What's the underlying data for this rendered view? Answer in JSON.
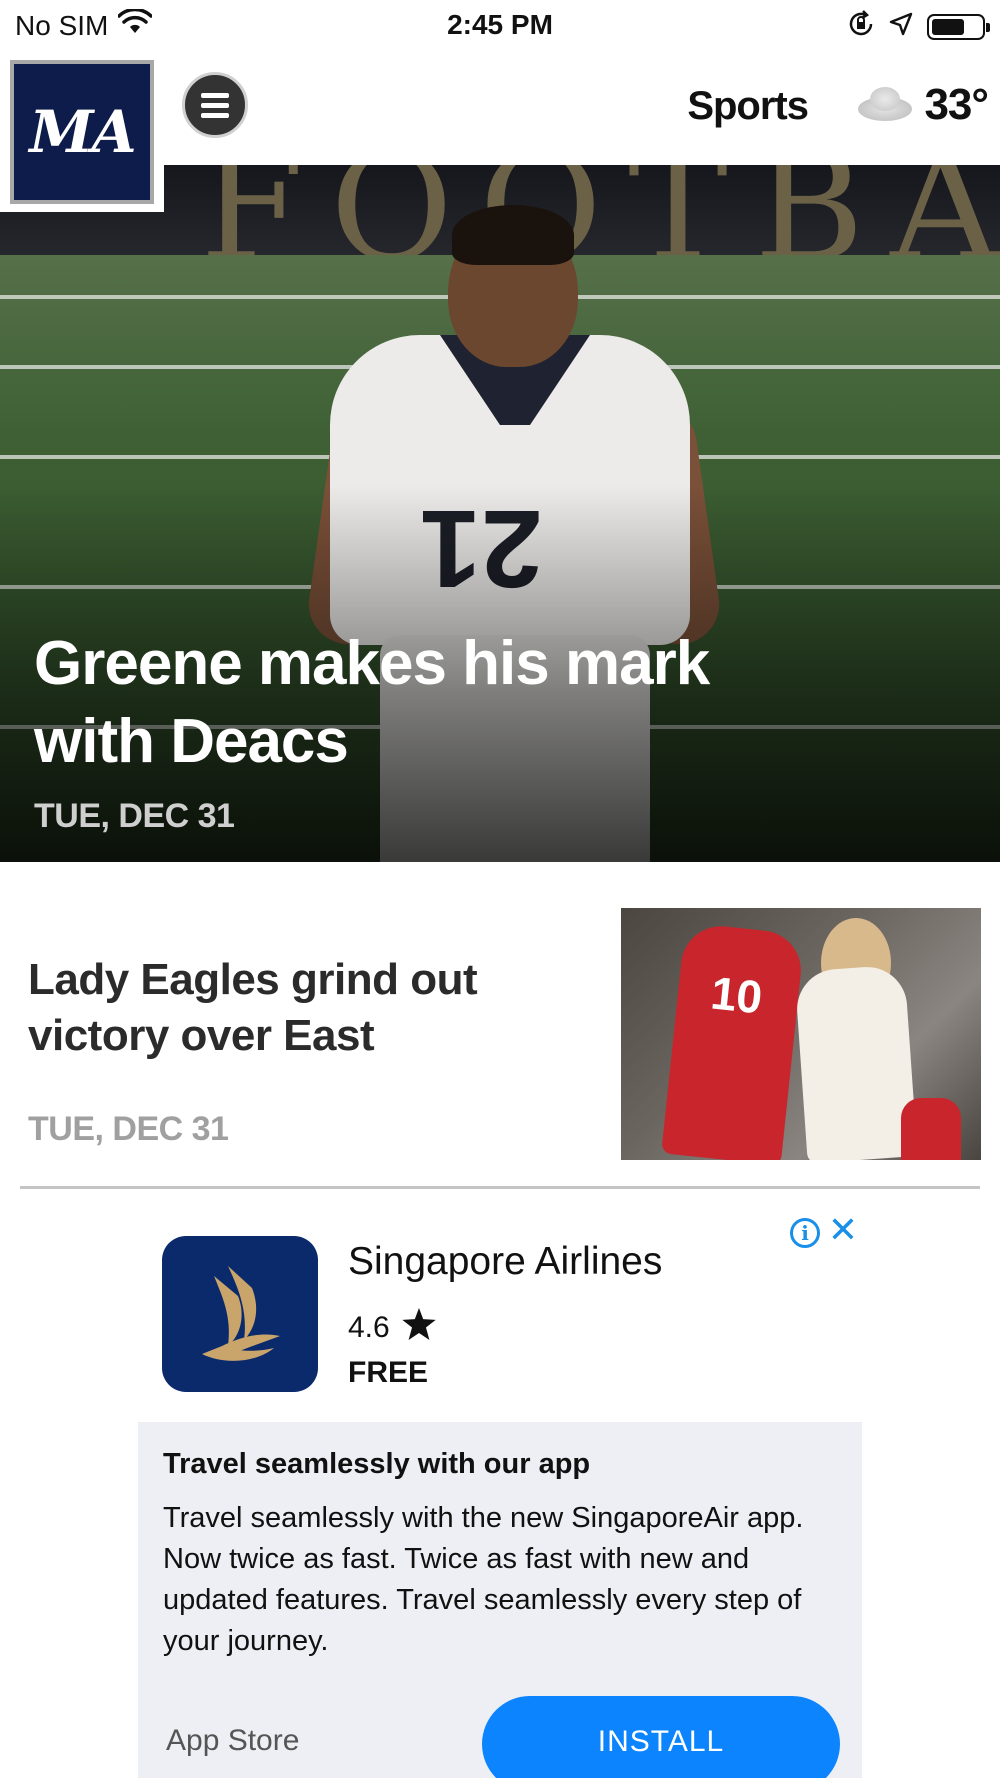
{
  "status_bar": {
    "carrier": "No SIM",
    "time": "2:45 PM"
  },
  "header": {
    "logo_text": "MA",
    "section": "Sports",
    "temperature": "33°",
    "weather_icon": "cloudy-icon"
  },
  "hero": {
    "title": "Greene makes his mark with Deacs",
    "date": "TUE, DEC 31"
  },
  "stories": [
    {
      "title": "Lady Eagles grind out victory over East",
      "date": "TUE, DEC 31"
    }
  ],
  "ad": {
    "app_name": "Singapore Airlines",
    "rating": "4.6",
    "price": "FREE",
    "headline": "Travel seamlessly with our app",
    "body": "Travel seamlessly with the new SingaporeAir app. Now twice as fast. Twice as fast with new and updated features. Travel seamlessly every step of your journey.",
    "store": "App Store",
    "install_label": "INSTALL",
    "info_glyph": "i",
    "close_glyph": "✕"
  },
  "colors": {
    "logo_bg": "#0d1c4a",
    "accent_blue": "#0b84fe",
    "ad_icon_bg": "#0b2a6c"
  }
}
